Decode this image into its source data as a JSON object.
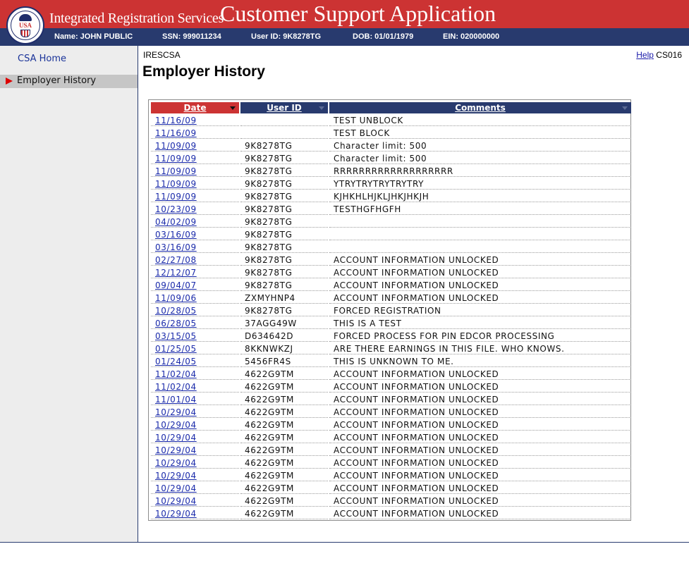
{
  "header": {
    "agency_title": "Integrated Registration Services",
    "app_title": "Customer Support Application",
    "logo_text": "USA",
    "name": "Name: JOHN PUBLIC",
    "ssn": "SSN: 999011234",
    "user_id": "User ID: 9K8278TG",
    "dob": "DOB: 01/01/1979",
    "ein": "EIN: 020000000"
  },
  "sidebar": {
    "items": [
      {
        "label": "CSA Home"
      },
      {
        "label": "Employer History"
      }
    ]
  },
  "page": {
    "screen_code": "IRESCSA",
    "help_label": "Help",
    "page_code": "CS016",
    "title": "Employer History"
  },
  "colors": {
    "banner_red": "#cc3333",
    "navy": "#283a6e",
    "sidebar_gray": "#ededed"
  },
  "table": {
    "columns": [
      "Date",
      "User ID",
      "Comments"
    ],
    "rows": [
      {
        "date": "11/16/09",
        "user_id": "",
        "comments": "TEST UNBLOCK"
      },
      {
        "date": "11/16/09",
        "user_id": "",
        "comments": "TEST BLOCK"
      },
      {
        "date": "11/09/09",
        "user_id": "9K8278TG",
        "comments": "Character limit: 500"
      },
      {
        "date": "11/09/09",
        "user_id": "9K8278TG",
        "comments": "Character limit: 500"
      },
      {
        "date": "11/09/09",
        "user_id": "9K8278TG",
        "comments": "RRRRRRRRRRRRRRRRRRR"
      },
      {
        "date": "11/09/09",
        "user_id": "9K8278TG",
        "comments": "YTRYTRYTRYTRYTRY"
      },
      {
        "date": "11/09/09",
        "user_id": "9K8278TG",
        "comments": "KJHKHLHJKLJHKJHKJH"
      },
      {
        "date": "10/23/09",
        "user_id": "9K8278TG",
        "comments": "TESTHGFHGFH"
      },
      {
        "date": "04/02/09",
        "user_id": "9K8278TG",
        "comments": ""
      },
      {
        "date": "03/16/09",
        "user_id": "9K8278TG",
        "comments": ""
      },
      {
        "date": "03/16/09",
        "user_id": "9K8278TG",
        "comments": ""
      },
      {
        "date": "02/27/08",
        "user_id": "9K8278TG",
        "comments": "ACCOUNT INFORMATION UNLOCKED"
      },
      {
        "date": "12/12/07",
        "user_id": "9K8278TG",
        "comments": "ACCOUNT INFORMATION UNLOCKED"
      },
      {
        "date": "09/04/07",
        "user_id": "9K8278TG",
        "comments": "ACCOUNT INFORMATION UNLOCKED"
      },
      {
        "date": "11/09/06",
        "user_id": "ZXMYHNP4",
        "comments": "ACCOUNT INFORMATION UNLOCKED"
      },
      {
        "date": "10/28/05",
        "user_id": "9K8278TG",
        "comments": "FORCED REGISTRATION"
      },
      {
        "date": "06/28/05",
        "user_id": "37AGG49W",
        "comments": "THIS IS A TEST"
      },
      {
        "date": "03/15/05",
        "user_id": "D634642D",
        "comments": "FORCED PROCESS FOR PIN EDCOR PROCESSING"
      },
      {
        "date": "01/25/05",
        "user_id": "8KKNWKZJ",
        "comments": "ARE THERE EARNINGS IN THIS FILE. WHO KNOWS."
      },
      {
        "date": "01/24/05",
        "user_id": "5456FR4S",
        "comments": "THIS IS UNKNOWN TO ME."
      },
      {
        "date": "11/02/04",
        "user_id": "4622G9TM",
        "comments": "ACCOUNT INFORMATION UNLOCKED"
      },
      {
        "date": "11/02/04",
        "user_id": "4622G9TM",
        "comments": "ACCOUNT INFORMATION UNLOCKED"
      },
      {
        "date": "11/01/04",
        "user_id": "4622G9TM",
        "comments": "ACCOUNT INFORMATION UNLOCKED"
      },
      {
        "date": "10/29/04",
        "user_id": "4622G9TM",
        "comments": "ACCOUNT INFORMATION UNLOCKED"
      },
      {
        "date": "10/29/04",
        "user_id": "4622G9TM",
        "comments": "ACCOUNT INFORMATION UNLOCKED"
      },
      {
        "date": "10/29/04",
        "user_id": "4622G9TM",
        "comments": "ACCOUNT INFORMATION UNLOCKED"
      },
      {
        "date": "10/29/04",
        "user_id": "4622G9TM",
        "comments": "ACCOUNT INFORMATION UNLOCKED"
      },
      {
        "date": "10/29/04",
        "user_id": "4622G9TM",
        "comments": "ACCOUNT INFORMATION UNLOCKED"
      },
      {
        "date": "10/29/04",
        "user_id": "4622G9TM",
        "comments": "ACCOUNT INFORMATION UNLOCKED"
      },
      {
        "date": "10/29/04",
        "user_id": "4622G9TM",
        "comments": "ACCOUNT INFORMATION UNLOCKED"
      },
      {
        "date": "10/29/04",
        "user_id": "4622G9TM",
        "comments": "ACCOUNT INFORMATION UNLOCKED"
      },
      {
        "date": "10/29/04",
        "user_id": "4622G9TM",
        "comments": "ACCOUNT INFORMATION UNLOCKED"
      }
    ]
  }
}
